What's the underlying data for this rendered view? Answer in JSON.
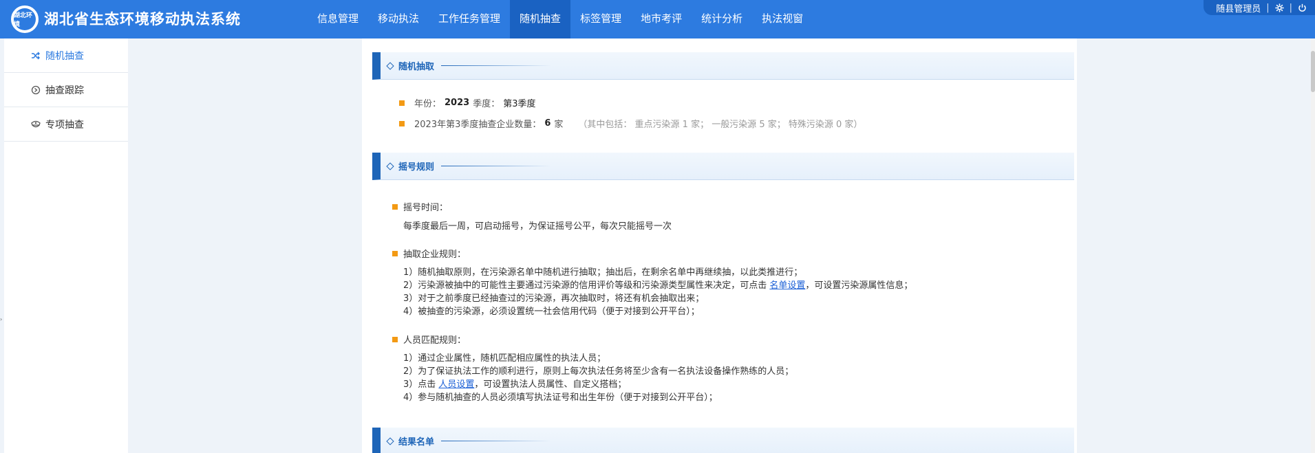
{
  "header": {
    "logo_text": "湖北环境",
    "title": "湖北省生态环境移动执法系统",
    "nav": [
      {
        "label": "信息管理",
        "active": false
      },
      {
        "label": "移动执法",
        "active": false
      },
      {
        "label": "工作任务管理",
        "active": false
      },
      {
        "label": "随机抽查",
        "active": true
      },
      {
        "label": "标签管理",
        "active": false
      },
      {
        "label": "地市考评",
        "active": false
      },
      {
        "label": "统计分析",
        "active": false
      },
      {
        "label": "执法视窗",
        "active": false
      }
    ],
    "user": "随县管理员",
    "separator": "|",
    "settings_icon": "gear-icon",
    "power_icon": "power-icon"
  },
  "sidebar": {
    "items": [
      {
        "label": "随机抽查",
        "icon": "shuffle-icon",
        "active": true
      },
      {
        "label": "抽查跟踪",
        "icon": "target-icon",
        "active": false
      },
      {
        "label": "专项抽查",
        "icon": "police-cap-icon",
        "active": false
      }
    ]
  },
  "sections": {
    "random": {
      "title": "随机抽取",
      "year_label": "年份：",
      "year": "2023",
      "quarter_label": "季度：",
      "quarter": "第3季度",
      "count_label": "2023年第3季度抽查企业数量：",
      "count": "6",
      "count_unit": "家",
      "breakdown": "（其中包括： 重点污染源 1 家； 一般污染源 5 家； 特殊污染源 0 家）"
    },
    "rules": {
      "title": "摇号规则",
      "time_title": "摇号时间：",
      "time_text": "每季度最后一周，可启动摇号，为保证摇号公平，每次只能摇号一次",
      "company_title": "抽取企业规则：",
      "company_rule1": "1）随机抽取原则，在污染源名单中随机进行抽取；抽出后，在剩余名单中再继续抽，以此类推进行；",
      "company_rule2_pre": "2）污染源被抽中的可能性主要通过污染源的信用评价等级和污染源类型属性来决定，可点击 ",
      "company_rule2_link": "名单设置",
      "company_rule2_post": "，可设置污染源属性信息；",
      "company_rule3": "3）对于之前季度已经抽查过的污染源，再次抽取时，将还有机会抽取出来；",
      "company_rule4": "4）被抽查的污染源，必须设置统一社会信用代码（便于对接到公开平台）；",
      "staff_title": "人员匹配规则：",
      "staff_rule1": "1）通过企业属性，随机匹配相应属性的执法人员；",
      "staff_rule2": "2）为了保证执法工作的顺利进行，原则上每次执法任务将至少含有一名执法设备操作熟练的人员；",
      "staff_rule3_pre": "3）点击 ",
      "staff_rule3_link": "人员设置",
      "staff_rule3_post": "，可设置执法人员属性、自定义搭档；",
      "staff_rule4": "4）参与随机抽查的人员必须填写执法证号和出生年份（便于对接到公开平台）；"
    },
    "results": {
      "title": "结果名单"
    }
  },
  "colors": {
    "header_bg": "#2d7be0",
    "nav_active_bg": "#1a62c2",
    "section_accent": "#1e65b8",
    "bullet": "#f39a14",
    "link": "#1a5fd6"
  }
}
